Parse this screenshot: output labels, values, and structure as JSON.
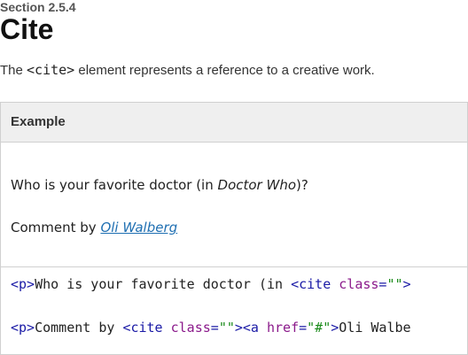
{
  "section": {
    "label": "Section 2.5.4",
    "title": "Cite",
    "desc_prefix": "The ",
    "desc_code": "<cite>",
    "desc_suffix": " element represents a reference to a creative work."
  },
  "example": {
    "header": "Example",
    "demo": {
      "question_prefix": "Who is your favorite doctor (in ",
      "question_cite": "Doctor Who",
      "question_suffix": ")?",
      "comment_prefix": "Comment by ",
      "comment_link": "Oli Walberg"
    },
    "code": {
      "line1": [
        {
          "t": "tag",
          "v": "<p>"
        },
        {
          "t": "txt",
          "v": "Who is your favorite doctor (in "
        },
        {
          "t": "tag",
          "v": "<cite "
        },
        {
          "t": "attr",
          "v": "class"
        },
        {
          "t": "tag",
          "v": "="
        },
        {
          "t": "str",
          "v": "\"\""
        },
        {
          "t": "tag",
          "v": ">"
        }
      ],
      "line2": [
        {
          "t": "tag",
          "v": "<p>"
        },
        {
          "t": "txt",
          "v": "Comment by "
        },
        {
          "t": "tag",
          "v": "<cite "
        },
        {
          "t": "attr",
          "v": "class"
        },
        {
          "t": "tag",
          "v": "="
        },
        {
          "t": "str",
          "v": "\"\""
        },
        {
          "t": "tag",
          "v": "><a "
        },
        {
          "t": "attr",
          "v": "href"
        },
        {
          "t": "tag",
          "v": "="
        },
        {
          "t": "str",
          "v": "\"#\""
        },
        {
          "t": "tag",
          "v": ">"
        },
        {
          "t": "txt",
          "v": "Oli Walbe"
        }
      ]
    }
  },
  "colors": {
    "tag": "#1a1aa6",
    "attr": "#8b1a8b",
    "string": "#1a8b1a",
    "link": "#1f6fb2",
    "header_bg": "#efefef",
    "border": "#d0d0d0"
  }
}
